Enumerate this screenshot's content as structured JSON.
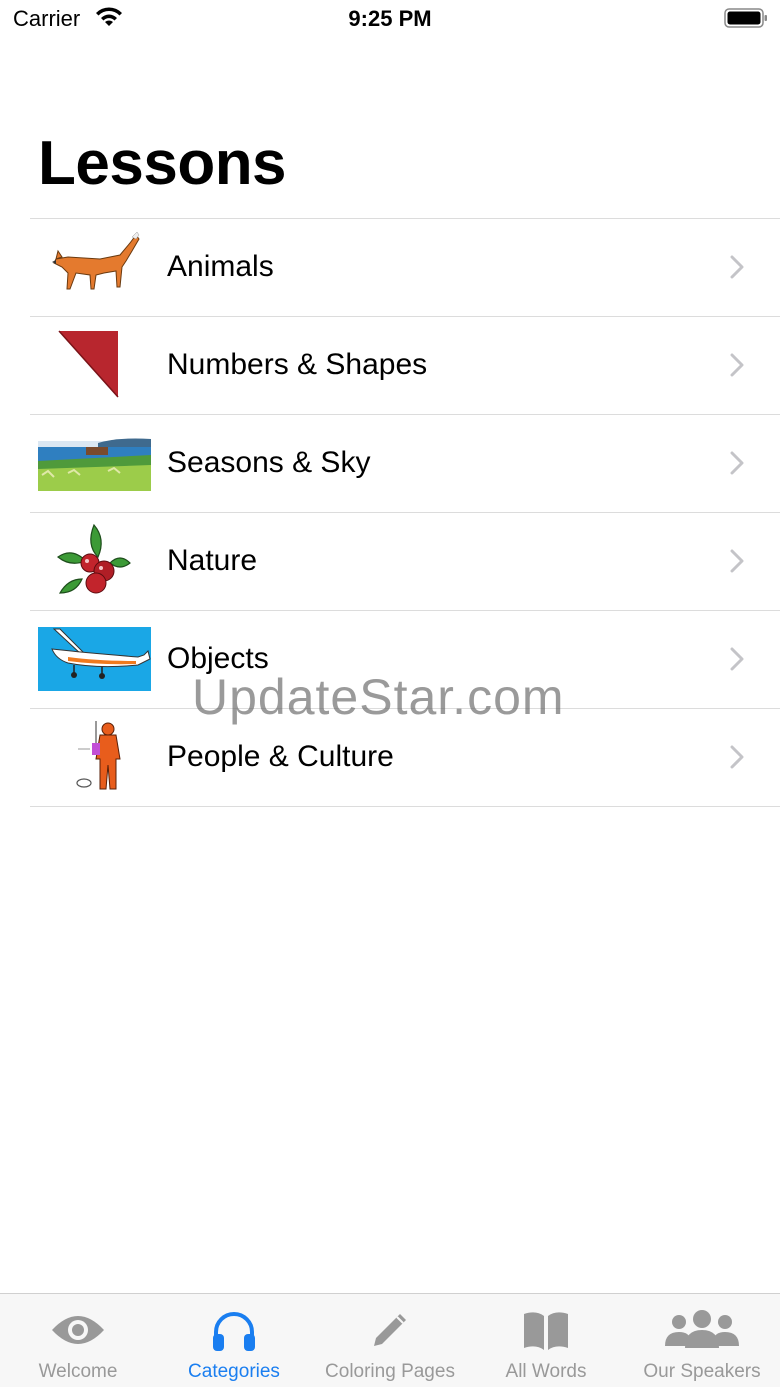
{
  "status_bar": {
    "carrier": "Carrier",
    "time": "9:25 PM"
  },
  "page": {
    "title": "Lessons"
  },
  "lessons": [
    {
      "label": "Animals",
      "icon": "fox-icon"
    },
    {
      "label": "Numbers & Shapes",
      "icon": "triangle-icon"
    },
    {
      "label": "Seasons & Sky",
      "icon": "landscape-icon"
    },
    {
      "label": "Nature",
      "icon": "berries-icon"
    },
    {
      "label": "Objects",
      "icon": "airplane-icon"
    },
    {
      "label": "People & Culture",
      "icon": "person-icon"
    }
  ],
  "watermark": "UpdateStar.com",
  "tabbar": {
    "active": "Categories",
    "tabs": [
      {
        "label": "Welcome",
        "icon": "eye-icon"
      },
      {
        "label": "Categories",
        "icon": "headphones-icon"
      },
      {
        "label": "Coloring Pages",
        "icon": "pencil-icon"
      },
      {
        "label": "All Words",
        "icon": "book-icon"
      },
      {
        "label": "Our Speakers",
        "icon": "group-icon"
      }
    ]
  },
  "colors": {
    "accent": "#1a7ef0",
    "inactive": "#999999",
    "separator": "#dcdcdc"
  }
}
